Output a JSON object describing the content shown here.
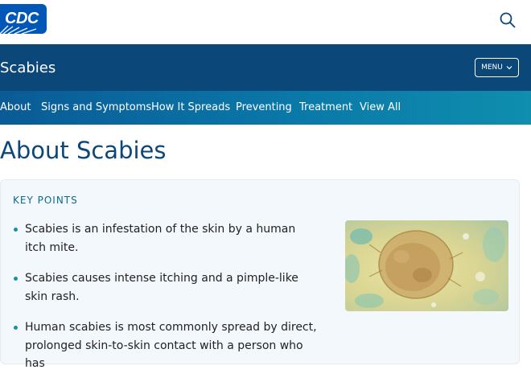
{
  "header": {
    "logo_text": "CDC",
    "search_icon": "search-icon"
  },
  "site": {
    "title": "Scabies",
    "menu_label": "MENU",
    "menu_icon": "chevron-down-icon"
  },
  "nav": {
    "items": [
      "About",
      "Signs and Symptoms",
      "How It Spreads",
      "Preventing",
      "Treatment",
      "View All"
    ]
  },
  "page": {
    "title": "About Scabies"
  },
  "key_points": {
    "heading": "KEY POINTS",
    "items": [
      "Scabies is an infestation of the skin by a human itch mite.",
      "Scabies causes intense itching and a pimple-like skin rash.",
      "Human scabies is most commonly spread by direct, prolonged skin-to-skin contact with a person who has"
    ]
  },
  "colors": {
    "brand_dark_blue": "#0b4778",
    "logo_blue": "#0057b7",
    "nav_gradient_start": "#0a5b96",
    "nav_gradient_end": "#0f8eae",
    "keypoints_bg": "#f3f8fd",
    "bullet_teal": "#1a8fa8"
  }
}
